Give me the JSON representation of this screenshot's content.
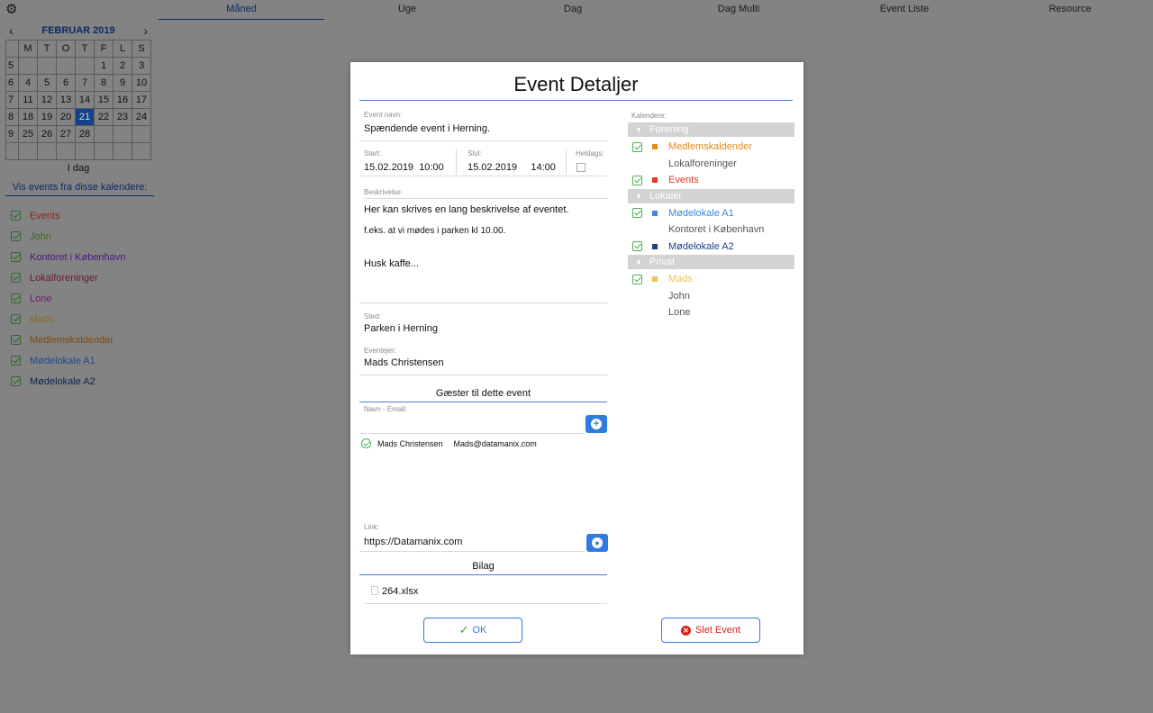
{
  "tabs": [
    "Måned",
    "Uge",
    "Dag",
    "Dag Multi",
    "Event Liste",
    "Resource"
  ],
  "mini_calendar": {
    "month": "FEBRUAR 2019",
    "weekday_headers": [
      "M",
      "T",
      "O",
      "T",
      "F",
      "L",
      "S"
    ],
    "weeks": [
      {
        "week": "5",
        "days": [
          "",
          "",
          "",
          "",
          "1",
          "2",
          "3"
        ]
      },
      {
        "week": "6",
        "days": [
          "4",
          "5",
          "6",
          "7",
          "8",
          "9",
          "10"
        ]
      },
      {
        "week": "7",
        "days": [
          "11",
          "12",
          "13",
          "14",
          "15",
          "16",
          "17"
        ]
      },
      {
        "week": "8",
        "days": [
          "18",
          "19",
          "20",
          "21",
          "22",
          "23",
          "24"
        ]
      },
      {
        "week": "9",
        "days": [
          "25",
          "26",
          "27",
          "28",
          "",
          "",
          ""
        ]
      },
      {
        "week": "",
        "days": [
          "",
          "",
          "",
          "",
          "",
          "",
          ""
        ]
      }
    ],
    "selected_day": "21",
    "today_label": "I dag"
  },
  "calendars_title": "Vis events fra disse kalendere:",
  "calendar_list": [
    {
      "name": "Events",
      "color": "#9a2310"
    },
    {
      "name": "John",
      "color": "#3d6b1e"
    },
    {
      "name": "Kontoret i København",
      "color": "#4a1a7a"
    },
    {
      "name": "Lokalforeninger",
      "color": "#6a1838"
    },
    {
      "name": "Lone",
      "color": "#6e1a6e"
    },
    {
      "name": "Mads",
      "color": "#8a6a28"
    },
    {
      "name": "Medlemskaldender",
      "color": "#7a4a10"
    },
    {
      "name": "Mødelokale A1",
      "color": "#1f4a8a"
    },
    {
      "name": "Mødelokale A2",
      "color": "#0d2350"
    }
  ],
  "modal": {
    "title": "Event Detaljer",
    "event_name_label": "Event navn:",
    "event_name": "Spændende event i Herning.",
    "start_label": "Start:",
    "start_date": "15.02.2019",
    "start_time": "10:00",
    "end_label": "Slut:",
    "end_date": "15.02.2019",
    "end_time": "14:00",
    "allday_label": "Heldags:",
    "description_label": "Beskrivelse:",
    "description_lines": [
      "Her kan skrives en lang beskrivelse af eventet.",
      "f.eks. at vi mødes i parken kl 10.00.",
      "Husk kaffe..."
    ],
    "place_label": "Sted:",
    "place": "Parken i Herning",
    "owner_label": "Eventejer:",
    "owner": "Mads Christensen",
    "guests_title": "Gæster til dette event",
    "guest_input_label": "Navn - Email:",
    "guests": [
      {
        "name": "Mads Christensen",
        "email": "Mads@datamanix.com"
      }
    ],
    "link_label": "Link:",
    "link": "https://Datamanix.com",
    "attachments_title": "Bilag",
    "attachment": "264.xlsx",
    "ok_label": "OK",
    "delete_label": "Slet Event",
    "calendars_label": "Kalendere:",
    "groups": [
      {
        "name": "Forening",
        "items": [
          {
            "name": "Medlemskaldender",
            "checked": true,
            "color": "#e88a1a"
          },
          {
            "name": "Lokalforeninger",
            "checked": false,
            "color": ""
          },
          {
            "name": "Events",
            "checked": true,
            "color": "#e2381c"
          }
        ]
      },
      {
        "name": "Lokaler",
        "items": [
          {
            "name": "Mødelokale A1",
            "checked": true,
            "color": "#3a86e0"
          },
          {
            "name": "Kontoret i København",
            "checked": false,
            "color": ""
          },
          {
            "name": "Mødelokale A2",
            "checked": true,
            "color": "#1a3f8a"
          }
        ]
      },
      {
        "name": "Privat",
        "items": [
          {
            "name": "Mads",
            "checked": true,
            "color": "#f2c24a"
          },
          {
            "name": "John",
            "checked": false,
            "color": ""
          },
          {
            "name": "Lone",
            "checked": false,
            "color": ""
          }
        ]
      }
    ]
  }
}
